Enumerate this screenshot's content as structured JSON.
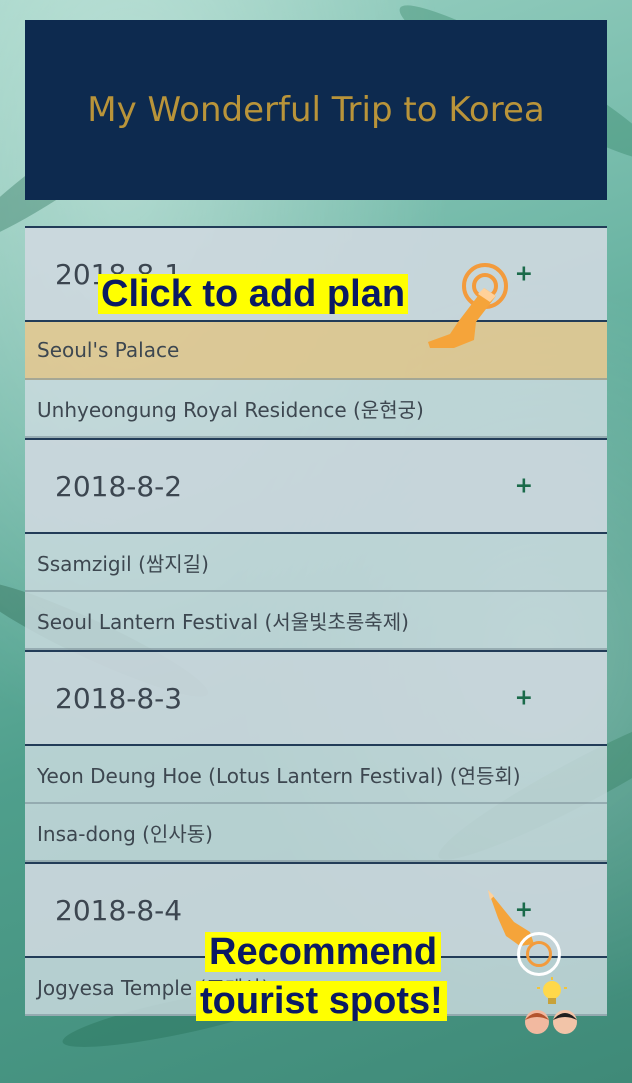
{
  "header": {
    "title": "My Wonderful Trip to Korea"
  },
  "days": [
    {
      "date": "2018-8-1",
      "add_label": "+",
      "items": [
        "Seoul's Palace",
        "Unhyeongung Royal Residence (운현궁)"
      ]
    },
    {
      "date": "2018-8-2",
      "add_label": "+",
      "items": [
        "Ssamzigil (쌈지길)",
        "Seoul Lantern Festival (서울빛초롱축제)"
      ]
    },
    {
      "date": "2018-8-3",
      "add_label": "+",
      "items": [
        "Yeon Deung Hoe (Lotus Lantern Festival) (연등회)",
        "Insa-dong (인사동)"
      ]
    },
    {
      "date": "2018-8-4",
      "add_label": "+",
      "items": [
        "Jogyesa Temple (조계사)"
      ]
    }
  ],
  "annotations": {
    "add_plan": "Click to add plan",
    "recommend_line1": "Recommend",
    "recommend_line2": "tourist spots!"
  },
  "colors": {
    "header_bg": "#0d2a4f",
    "title_color": "#b9943a",
    "highlight_item": "#dfc894",
    "callout_bg": "#ffff00",
    "callout_text": "#0a1a63",
    "add_icon": "#1a6a4a"
  },
  "icons": [
    "tap-hand-icon",
    "lightbulb-icon",
    "people-icon"
  ]
}
